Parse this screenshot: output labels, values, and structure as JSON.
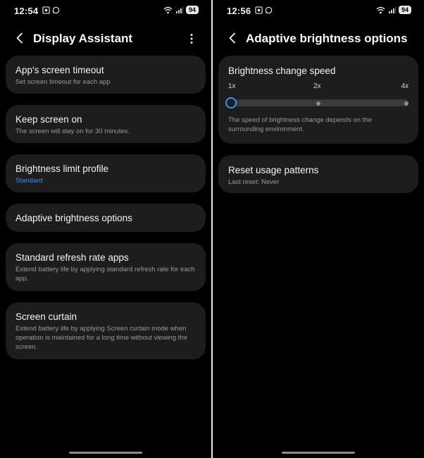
{
  "left_screen": {
    "status": {
      "time": "12:54",
      "battery": "94"
    },
    "header": {
      "title": "Display Assistant"
    },
    "cards": [
      {
        "title": "App's screen timeout",
        "subtitle": "Set screen timeout for each app"
      },
      {
        "title": "Keep screen on",
        "subtitle": "The screen will stay on for 30 minutes."
      },
      {
        "title": "Brightness limit profile",
        "subtitle": "Standard"
      },
      {
        "title": "Adaptive brightness options"
      },
      {
        "title": "Standard refresh rate apps",
        "subtitle": "Extend battery life by applying standard refresh rate for each app."
      },
      {
        "title": "Screen curtain",
        "subtitle": "Extend battery life by applying Screen curtain mode when operation is maintained for a long time without viewing the screen."
      }
    ]
  },
  "right_screen": {
    "status": {
      "time": "12:56",
      "battery": "94"
    },
    "header": {
      "title": "Adaptive brightness options"
    },
    "brightness_speed": {
      "title": "Brightness change speed",
      "labels": [
        "1x",
        "2x",
        "4x"
      ],
      "selected_index": 0,
      "description": "The speed of brightness change depends on the surrounding environment."
    },
    "reset": {
      "title": "Reset usage patterns",
      "subtitle": "Last reset: Never"
    }
  },
  "colors": {
    "accent": "#3e8ef7",
    "card_background": "#1d1d1d",
    "background": "#000000"
  },
  "icons": [
    "screenshot-icon",
    "whatsapp-icon",
    "wifi-icon",
    "signal-icon",
    "battery-icon",
    "back-arrow-icon",
    "more-options-icon"
  ]
}
